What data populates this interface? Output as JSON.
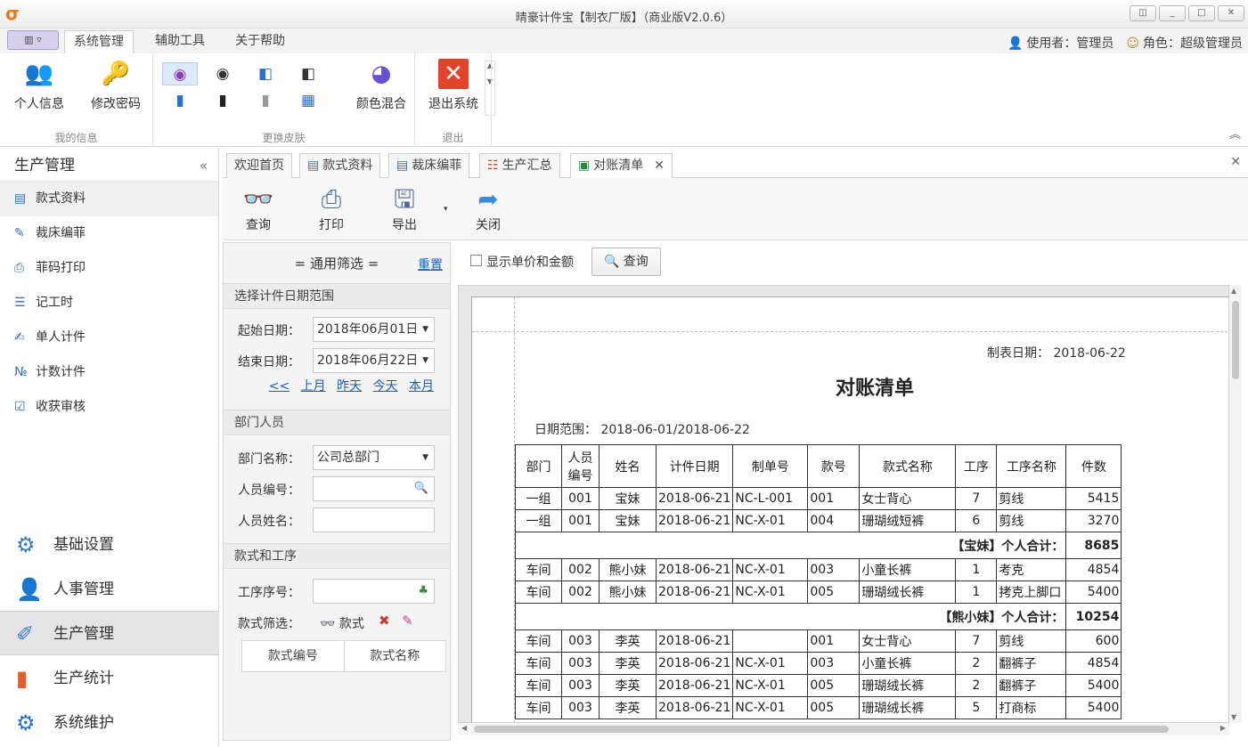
{
  "window": {
    "title": "晴豪计件宝【制衣厂版】（商业版V2.0.6）"
  },
  "menu": {
    "tabs": [
      "系统管理",
      "辅助工具",
      "关于帮助"
    ],
    "user_label": "使用者：管理员",
    "role_label": "角色：超级管理员"
  },
  "ribbon": {
    "my_info": {
      "label": "我的信息",
      "buttons": [
        "个人信息",
        "修改密码"
      ]
    },
    "skin": {
      "label": "更换皮肤",
      "mix_label": "颜色混合"
    },
    "exit": {
      "label": "退出",
      "button": "退出系统"
    }
  },
  "leftnav": {
    "title": "生产管理",
    "items": [
      "款式资料",
      "裁床编菲",
      "菲码打印",
      "记工时",
      "单人计件",
      "计数计件",
      "收获审核"
    ],
    "groups": [
      "基础设置",
      "人事管理",
      "生产管理",
      "生产统计",
      "系统维护"
    ]
  },
  "doctabs": [
    "欢迎首页",
    "款式资料",
    "裁床编菲",
    "生产汇总",
    "对账清单"
  ],
  "toolbar": {
    "buttons": [
      "查询",
      "打印",
      "导出",
      "关闭"
    ]
  },
  "filter": {
    "title": "= 通用筛选 =",
    "reset": "重置",
    "date_section": "选择计件日期范围",
    "start_label": "起始日期：",
    "start_value": "2018年06月01日",
    "end_label": "结束日期：",
    "end_value": "2018年06月22日",
    "quick": [
      "<<",
      "上月",
      "昨天",
      "今天",
      "本月"
    ],
    "dept_section": "部门人员",
    "dept_label": "部门名称：",
    "dept_value": "公司总部门",
    "emp_no_label": "人员编号：",
    "emp_name_label": "人员姓名：",
    "style_section": "款式和工序",
    "proc_no_label": "工序序号：",
    "style_filter_label": "款式筛选：",
    "style_btn": "款式",
    "cols": [
      "款式编号",
      "款式名称"
    ]
  },
  "main": {
    "show_price_label": "显示单价和金额",
    "query_btn": "查询"
  },
  "report": {
    "made_date": "制表日期： 2018-06-22",
    "title": "对账清单",
    "range": "日期范围： 2018-06-01/2018-06-22",
    "headers": [
      "部门",
      "人员编号",
      "姓名",
      "计件日期",
      "制单号",
      "款号",
      "款式名称",
      "工序",
      "工序名称",
      "件数"
    ],
    "rows": [
      {
        "type": "row",
        "cells": [
          "一组",
          "001",
          "宝妹",
          "2018-06-21",
          "NC-L-001",
          "001",
          "女士背心",
          "7",
          "剪线",
          "5415"
        ]
      },
      {
        "type": "row",
        "cells": [
          "一组",
          "001",
          "宝妹",
          "2018-06-21",
          "NC-X-01",
          "004",
          "珊瑚绒短裤",
          "6",
          "剪线",
          "3270"
        ]
      },
      {
        "type": "sub",
        "label": "【宝妹】个人合计：",
        "total": "8685"
      },
      {
        "type": "row",
        "cells": [
          "车间",
          "002",
          "熊小妹",
          "2018-06-21",
          "NC-X-01",
          "003",
          "小童长裤",
          "1",
          "考克",
          "4854"
        ]
      },
      {
        "type": "row",
        "cells": [
          "车间",
          "002",
          "熊小妹",
          "2018-06-21",
          "NC-X-01",
          "005",
          "珊瑚绒长裤",
          "1",
          "拷克上脚口",
          "5400"
        ]
      },
      {
        "type": "sub",
        "label": "【熊小妹】个人合计：",
        "total": "10254"
      },
      {
        "type": "row",
        "cells": [
          "车间",
          "003",
          "李英",
          "2018-06-21",
          "",
          "001",
          "女士背心",
          "7",
          "剪线",
          "600"
        ]
      },
      {
        "type": "row",
        "cells": [
          "车间",
          "003",
          "李英",
          "2018-06-21",
          "NC-X-01",
          "003",
          "小童长裤",
          "2",
          "翻裤子",
          "4854"
        ]
      },
      {
        "type": "row",
        "cells": [
          "车间",
          "003",
          "李英",
          "2018-06-21",
          "NC-X-01",
          "005",
          "珊瑚绒长裤",
          "2",
          "翻裤子",
          "5400"
        ]
      },
      {
        "type": "row",
        "cells": [
          "车间",
          "003",
          "李英",
          "2018-06-21",
          "NC-X-01",
          "005",
          "珊瑚绒长裤",
          "5",
          "打商标",
          "5400"
        ]
      }
    ]
  }
}
